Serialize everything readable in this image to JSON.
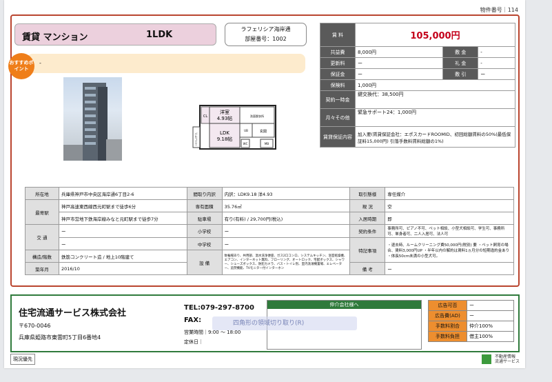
{
  "header": {
    "doc_number": "物件番号｜114"
  },
  "title": {
    "type_label": "賃貸 マンション",
    "layout": "1LDK"
  },
  "building": {
    "name": "ラフェリシア海岸通",
    "room": "部屋番号：1002"
  },
  "osusume": {
    "badge": "おすすめポイント",
    "text": "-"
  },
  "floor_plan": {
    "western": "洋室",
    "western_size": "4.93帖",
    "ldk": "LDK",
    "ldk_size": "9.18帖",
    "cl": "CL",
    "balcony": "バルコニー",
    "washroom": "洗面脱衣所",
    "entrance": "玄関",
    "mb": "MB",
    "wc": "WC",
    "ub": "UB"
  },
  "price": {
    "rent_label": "賃 料",
    "rent": "105,000円",
    "kyoeki_label": "共益費",
    "kyoeki": "8,000円",
    "shikikin_label": "敷 金",
    "shikikin": "-",
    "koshin_label": "更新料",
    "koshin": "ー",
    "reikin_label": "礼 金",
    "reikin": "-",
    "hosho_label": "保証金",
    "hosho": "ー",
    "shikibiki_label": "敷 引",
    "shikibiki": "ー",
    "hoken_label": "保険料",
    "hoken": "1,000円",
    "ichiji_label": "契約一時金",
    "ichiji": "鍵交換代：38,500円",
    "tsukiji_label": "月々その他",
    "tsukiji": "緊急サポート24：1,000円",
    "hoshokaisha_label": "賃貸保証内容",
    "hoshokaisha": "加入要(賃貸保証会社：エポスカードROOMID、初回総額賃料の50%(最低保証料15,000円) 引落手数料賃料総額の1%)"
  },
  "info": {
    "location_label": "所在地",
    "location": "兵庫県神戸市中央区海岸通6丁目2-6",
    "madori_label": "間取り内訳",
    "madori": "内訳：LDK9.18 洋4.93",
    "torihiki_label": "取引態様",
    "torihiki": "専任媒介",
    "station_label": "最寄駅",
    "station1": "神戸高速東西線西元町駅まで徒歩6分",
    "station2": "神戸市営地下鉄海岸線みなと元町駅まで徒歩7分",
    "area_label": "専有面積",
    "area": "35.76㎡",
    "genkyo_label": "現 況",
    "genkyo": "空",
    "parking_label": "駐車場",
    "parking": "有り(有料) / 29,700円(税込)",
    "nyukyo_label": "入居時期",
    "nyukyo": "即",
    "kotsu_label": "交 通",
    "kotsu1": "ー",
    "kotsu2": "ー",
    "elem_label": "小学校",
    "elem": "ー",
    "jhs_label": "中学校",
    "jhs": "ー",
    "joken_label": "契約条件",
    "joken": "事務所可、ピアノ不可、ペット相談、小型犬相談可、学生可、事務所可、単身者可、二人入居可、法人可",
    "tokki_label": "特記事項",
    "tokki": "・退去時、ルームクリーニング費50,000円(税別) 要 ・ペット飼育の場合、賃料3,000円UP ・半年以内の解約は賃料1ヵ月分の短期違約金あり ・体長50cm未満の小型犬可。",
    "structure_label": "構造/階数",
    "structure": "鉄筋コンクリート造 / 地上10階建て",
    "setsubi_label": "設 備",
    "setsubi": "駐輪場あり、共用部、温水洗浄便座、ガス2口コンロ、システムキッチン、浴室乾燥機、エアコン、インターネット無料、フローリング、オートロック、宅配ボックス、シャワー、シューズボックス、防犯カメラ、バス・トイレ別、室内洗濯機置場、エレベーター、追焚機能、TVモニター付インターホン",
    "built_label": "築年月",
    "built": "2016/10",
    "biko_label": "備 考",
    "biko": "ー"
  },
  "footer": {
    "company": "住宅流通サービス株式会社",
    "postal": "〒670-0046",
    "address": "兵庫県姫路市東雲町5丁目6番地4",
    "tel": "TEL:079-297-8700",
    "fax": "FAX:",
    "hours": "営業時間｜9:00 〜 18:00",
    "holiday": "定休日｜",
    "agent_header": "仲介会社様へ",
    "ad_label": "広告可否",
    "ad": "ー",
    "adfee_label": "広告費(AD)",
    "adfee": "ー",
    "fee_label": "手数料割合",
    "fee": "仲介100%",
    "burden_label": "手数料負担",
    "burden": "借主100%",
    "overlay": "四角形の領域切り取り(R)"
  },
  "buttons": {
    "genkyo_btn": "現況優先"
  },
  "stamp": {
    "line1": "不動産情報",
    "line2": "流通サービス"
  }
}
